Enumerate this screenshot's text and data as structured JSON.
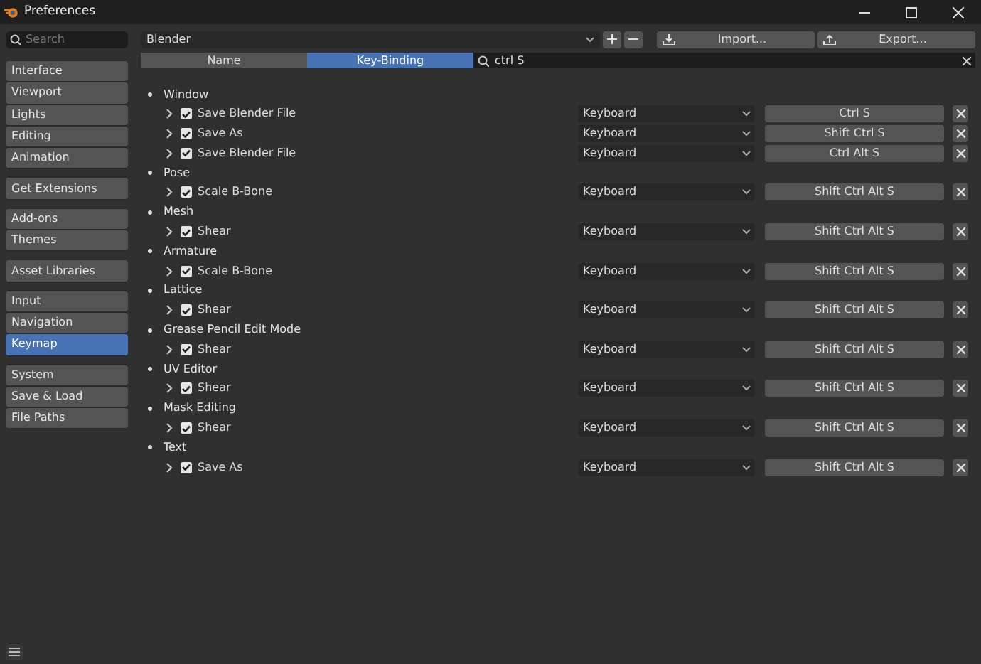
{
  "window": {
    "title": "Preferences"
  },
  "sidebar": {
    "search": {
      "placeholder": "Search"
    },
    "groups": [
      {
        "items": [
          {
            "label": "Interface",
            "selected": false
          },
          {
            "label": "Viewport",
            "selected": false
          },
          {
            "label": "Lights",
            "selected": false
          },
          {
            "label": "Editing",
            "selected": false
          },
          {
            "label": "Animation",
            "selected": false
          }
        ]
      },
      {
        "items": [
          {
            "label": "Get Extensions",
            "selected": false
          }
        ]
      },
      {
        "items": [
          {
            "label": "Add-ons",
            "selected": false
          },
          {
            "label": "Themes",
            "selected": false
          }
        ]
      },
      {
        "items": [
          {
            "label": "Asset Libraries",
            "selected": false
          }
        ]
      },
      {
        "items": [
          {
            "label": "Input",
            "selected": false
          },
          {
            "label": "Navigation",
            "selected": false
          },
          {
            "label": "Keymap",
            "selected": true
          }
        ]
      },
      {
        "items": [
          {
            "label": "System",
            "selected": false
          },
          {
            "label": "Save & Load",
            "selected": false
          },
          {
            "label": "File Paths",
            "selected": false
          }
        ]
      }
    ]
  },
  "preset": {
    "value": "Blender",
    "import_label": "Import...",
    "export_label": "Export..."
  },
  "filter_tabs": [
    {
      "label": "Name",
      "selected": false
    },
    {
      "label": "Key-Binding",
      "selected": true
    }
  ],
  "filter_search": {
    "value": "ctrl S"
  },
  "keymap": [
    {
      "section": "Window",
      "items": [
        {
          "name": "Save Blender File",
          "expanded": false,
          "checked": true,
          "input_type": "Keyboard",
          "binding": "Ctrl S"
        },
        {
          "name": "Save As",
          "expanded": false,
          "checked": true,
          "input_type": "Keyboard",
          "binding": "Shift Ctrl S"
        },
        {
          "name": "Save Blender File",
          "expanded": false,
          "checked": true,
          "input_type": "Keyboard",
          "binding": "Ctrl Alt S"
        }
      ]
    },
    {
      "section": "Pose",
      "items": [
        {
          "name": "Scale B-Bone",
          "expanded": false,
          "checked": true,
          "input_type": "Keyboard",
          "binding": "Shift Ctrl Alt S"
        }
      ]
    },
    {
      "section": "Mesh",
      "items": [
        {
          "name": "Shear",
          "expanded": false,
          "checked": true,
          "input_type": "Keyboard",
          "binding": "Shift Ctrl Alt S"
        }
      ]
    },
    {
      "section": "Armature",
      "items": [
        {
          "name": "Scale B-Bone",
          "expanded": false,
          "checked": true,
          "input_type": "Keyboard",
          "binding": "Shift Ctrl Alt S"
        }
      ]
    },
    {
      "section": "Lattice",
      "items": [
        {
          "name": "Shear",
          "expanded": false,
          "checked": true,
          "input_type": "Keyboard",
          "binding": "Shift Ctrl Alt S"
        }
      ]
    },
    {
      "section": "Grease Pencil Edit Mode",
      "items": [
        {
          "name": "Shear",
          "expanded": false,
          "checked": true,
          "input_type": "Keyboard",
          "binding": "Shift Ctrl Alt S"
        }
      ]
    },
    {
      "section": "UV Editor",
      "items": [
        {
          "name": "Shear",
          "expanded": false,
          "checked": true,
          "input_type": "Keyboard",
          "binding": "Shift Ctrl Alt S"
        }
      ]
    },
    {
      "section": "Mask Editing",
      "items": [
        {
          "name": "Shear",
          "expanded": false,
          "checked": true,
          "input_type": "Keyboard",
          "binding": "Shift Ctrl Alt S"
        }
      ]
    },
    {
      "section": "Text",
      "items": [
        {
          "name": "Save As",
          "expanded": false,
          "checked": true,
          "input_type": "Keyboard",
          "binding": "Shift Ctrl Alt S"
        }
      ]
    }
  ]
}
